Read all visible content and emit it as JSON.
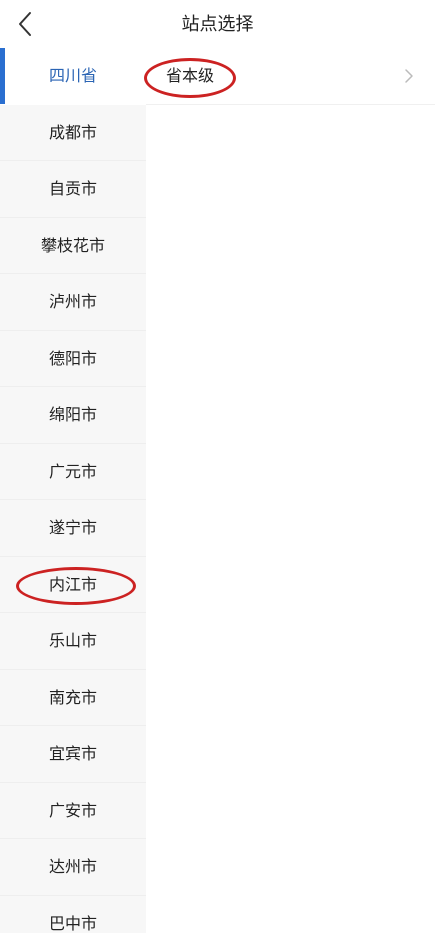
{
  "header": {
    "title": "站点选择",
    "back_icon": "chevron-left-icon"
  },
  "sidebar": {
    "items": [
      {
        "label": "四川省",
        "active": true
      },
      {
        "label": "成都市"
      },
      {
        "label": "自贡市"
      },
      {
        "label": "攀枝花市"
      },
      {
        "label": "泸州市"
      },
      {
        "label": "德阳市"
      },
      {
        "label": "绵阳市"
      },
      {
        "label": "广元市"
      },
      {
        "label": "遂宁市"
      },
      {
        "label": "内江市"
      },
      {
        "label": "乐山市"
      },
      {
        "label": "南充市"
      },
      {
        "label": "宜宾市"
      },
      {
        "label": "广安市"
      },
      {
        "label": "达州市"
      },
      {
        "label": "巴中市"
      }
    ]
  },
  "content": {
    "rows": [
      {
        "label": "省本级",
        "icon": "chevron-right-icon"
      }
    ]
  },
  "colors": {
    "accent": "#2a6fd0",
    "active_text": "#2a64b4",
    "annotation": "#cc2222",
    "sidebar_bg": "#f7f7f7"
  }
}
